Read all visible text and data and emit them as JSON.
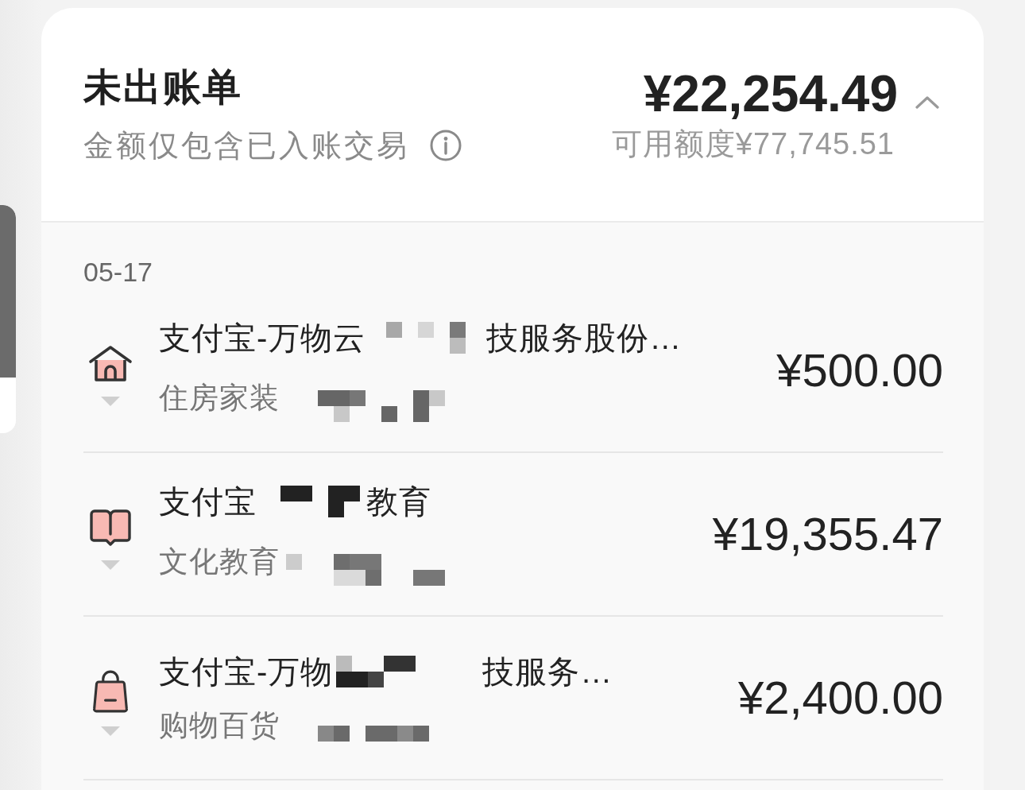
{
  "bill": {
    "title": "未出账单",
    "note": "金额仅包含已入账交易",
    "amount": "¥22,254.49",
    "expanded": true,
    "available_credit": "可用额度¥77,745.51"
  },
  "transactions": {
    "date": "05-17",
    "items": [
      {
        "kind": "home",
        "title_segments": [
          "支付宝-万物云",
          "技服务股份…"
        ],
        "category": "住房家装",
        "category_redacted": true,
        "amount": "¥500.00"
      },
      {
        "kind": "education",
        "title_segments": [
          "支付宝",
          "教育"
        ],
        "category": "文化教育",
        "category_redacted": true,
        "amount": "¥19,355.47"
      },
      {
        "kind": "shopping",
        "title_segments": [
          "支付宝-万物",
          "技服务…"
        ],
        "category": "购物百货",
        "category_redacted": true,
        "amount": "¥2,400.00"
      }
    ]
  }
}
